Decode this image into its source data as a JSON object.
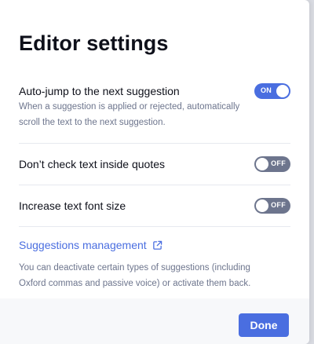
{
  "dialog": {
    "title": "Editor settings"
  },
  "settings": [
    {
      "label": "Auto-jump to the next suggestion",
      "description": "When a suggestion is applied or rejected, automatically scroll the text to the next suggestion.",
      "state": "ON",
      "enabled": true
    },
    {
      "label": "Don’t check text inside quotes",
      "state": "OFF",
      "enabled": false
    },
    {
      "label": "Increase text font size",
      "state": "OFF",
      "enabled": false
    }
  ],
  "management": {
    "link_label": "Suggestions management",
    "link_icon": "external-link-icon",
    "description": "You can deactivate certain types of suggestions (including Oxford commas and passive voice) or activate them back."
  },
  "footer": {
    "done_label": "Done"
  },
  "colors": {
    "accent": "#4a6ee0",
    "toggle_off": "#6d758d",
    "muted_text": "#6d758d",
    "text": "#0e101a"
  }
}
